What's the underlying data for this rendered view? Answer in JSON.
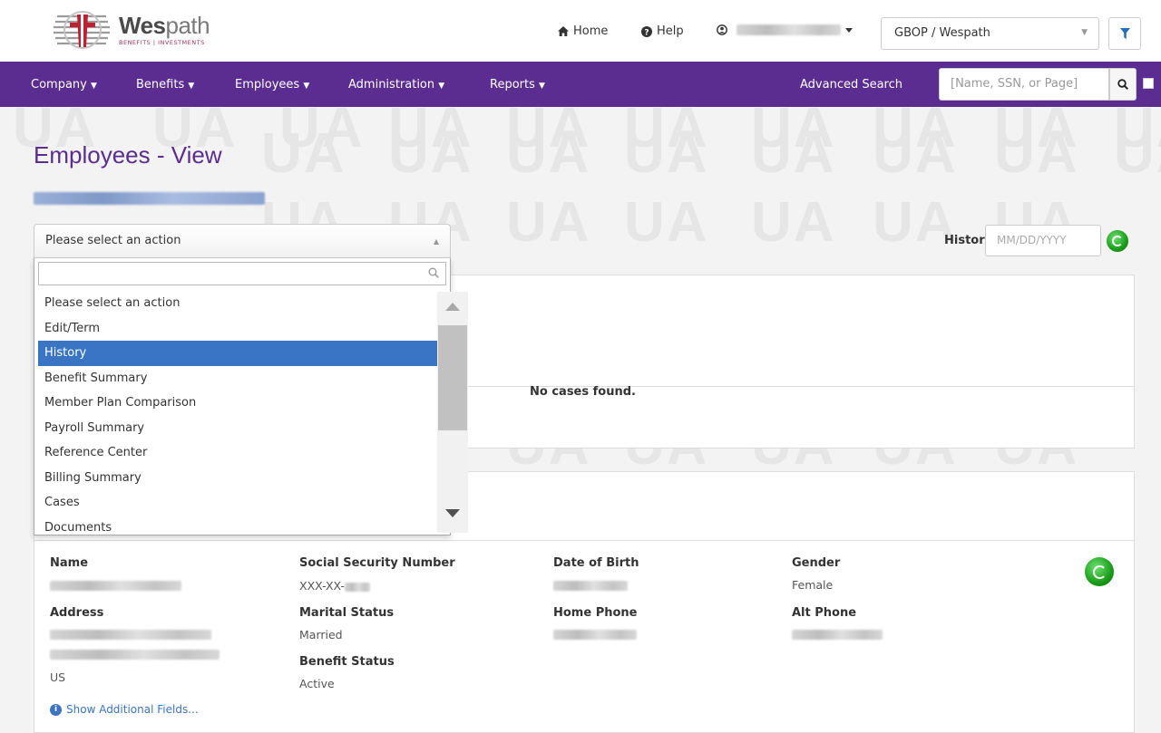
{
  "header": {
    "logo": {
      "name_bold": "Wes",
      "name_light": "path",
      "tagline": "BENEFITS | INVESTMENTS"
    },
    "home_label": "Home",
    "help_label": "Help",
    "organization": "GBOP / Wespath"
  },
  "nav": {
    "items": [
      {
        "label": "Company"
      },
      {
        "label": "Benefits"
      },
      {
        "label": "Employees"
      },
      {
        "label": "Administration"
      },
      {
        "label": "Reports"
      }
    ],
    "advanced_search": "Advanced Search",
    "search_placeholder": "[Name, SSN, or Page]"
  },
  "watermark": "UA",
  "page": {
    "title": "Employees - View",
    "history_label": "History",
    "history_placeholder": "MM/DD/YYYY"
  },
  "action_select": {
    "selected": "Please select an action",
    "options": [
      {
        "label": "Please select an action"
      },
      {
        "label": "Edit/Term"
      },
      {
        "label": "History"
      },
      {
        "label": "Benefit Summary"
      },
      {
        "label": "Member Plan Comparison"
      },
      {
        "label": "Payroll Summary"
      },
      {
        "label": "Reference Center"
      },
      {
        "label": "Billing Summary"
      },
      {
        "label": "Cases"
      },
      {
        "label": "Documents"
      }
    ],
    "highlighted_index": 2
  },
  "cases": {
    "empty_message": "No cases found."
  },
  "demographics": {
    "name_label": "Name",
    "ssn_label": "Social Security Number",
    "ssn_value": "XXX-XX-",
    "dob_label": "Date of Birth",
    "gender_label": "Gender",
    "gender_value": "Female",
    "address_label": "Address",
    "address_country": "US",
    "marital_label": "Marital Status",
    "marital_value": "Married",
    "home_phone_label": "Home Phone",
    "alt_phone_label": "Alt Phone",
    "benefit_status_label": "Benefit Status",
    "benefit_status_value": "Active",
    "show_more": "Show Additional Fields..."
  },
  "colors": {
    "brand_purple": "#5b2d91",
    "selection_blue": "#3a75c4",
    "go_green": "#1a9c1a"
  }
}
